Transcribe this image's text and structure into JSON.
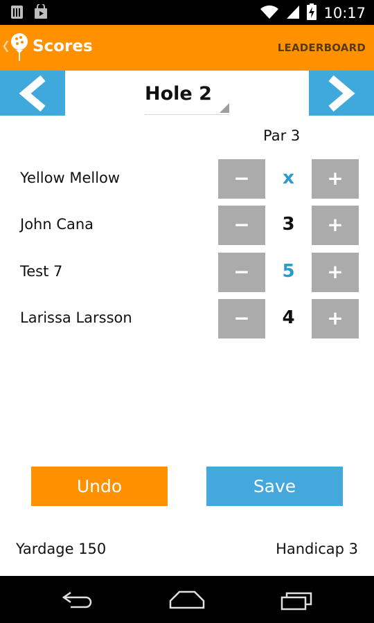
{
  "status_bar": {
    "time": "10:17",
    "icons": [
      "sim-card-icon",
      "shop-bag-icon",
      "wifi-icon",
      "signal-icon",
      "battery-charging-icon"
    ]
  },
  "action_bar": {
    "title": "Scores",
    "action": "LEADERBOARD",
    "background": "#ff9100"
  },
  "hole_nav": {
    "hole": "Hole 2",
    "prev_icon": "chevron-left-icon",
    "next_icon": "chevron-right-icon",
    "accent": "#3fa9dc"
  },
  "par": "Par 3",
  "players": [
    {
      "name": "Yellow Mellow",
      "score": "x",
      "score_color": "blue",
      "minus": "−",
      "plus": "+"
    },
    {
      "name": "John Cana",
      "score": "3",
      "score_color": "dark",
      "minus": "−",
      "plus": "+"
    },
    {
      "name": "Test 7",
      "score": "5",
      "score_color": "blue",
      "minus": "−",
      "plus": "+"
    },
    {
      "name": "Larissa Larsson",
      "score": "4",
      "score_color": "dark",
      "minus": "−",
      "plus": "+"
    }
  ],
  "buttons": {
    "undo": "Undo",
    "save": "Save"
  },
  "footer": {
    "yardage": "Yardage 150",
    "handicap": "Handicap 3"
  },
  "system_nav": [
    "back-icon",
    "home-icon",
    "recents-icon"
  ]
}
